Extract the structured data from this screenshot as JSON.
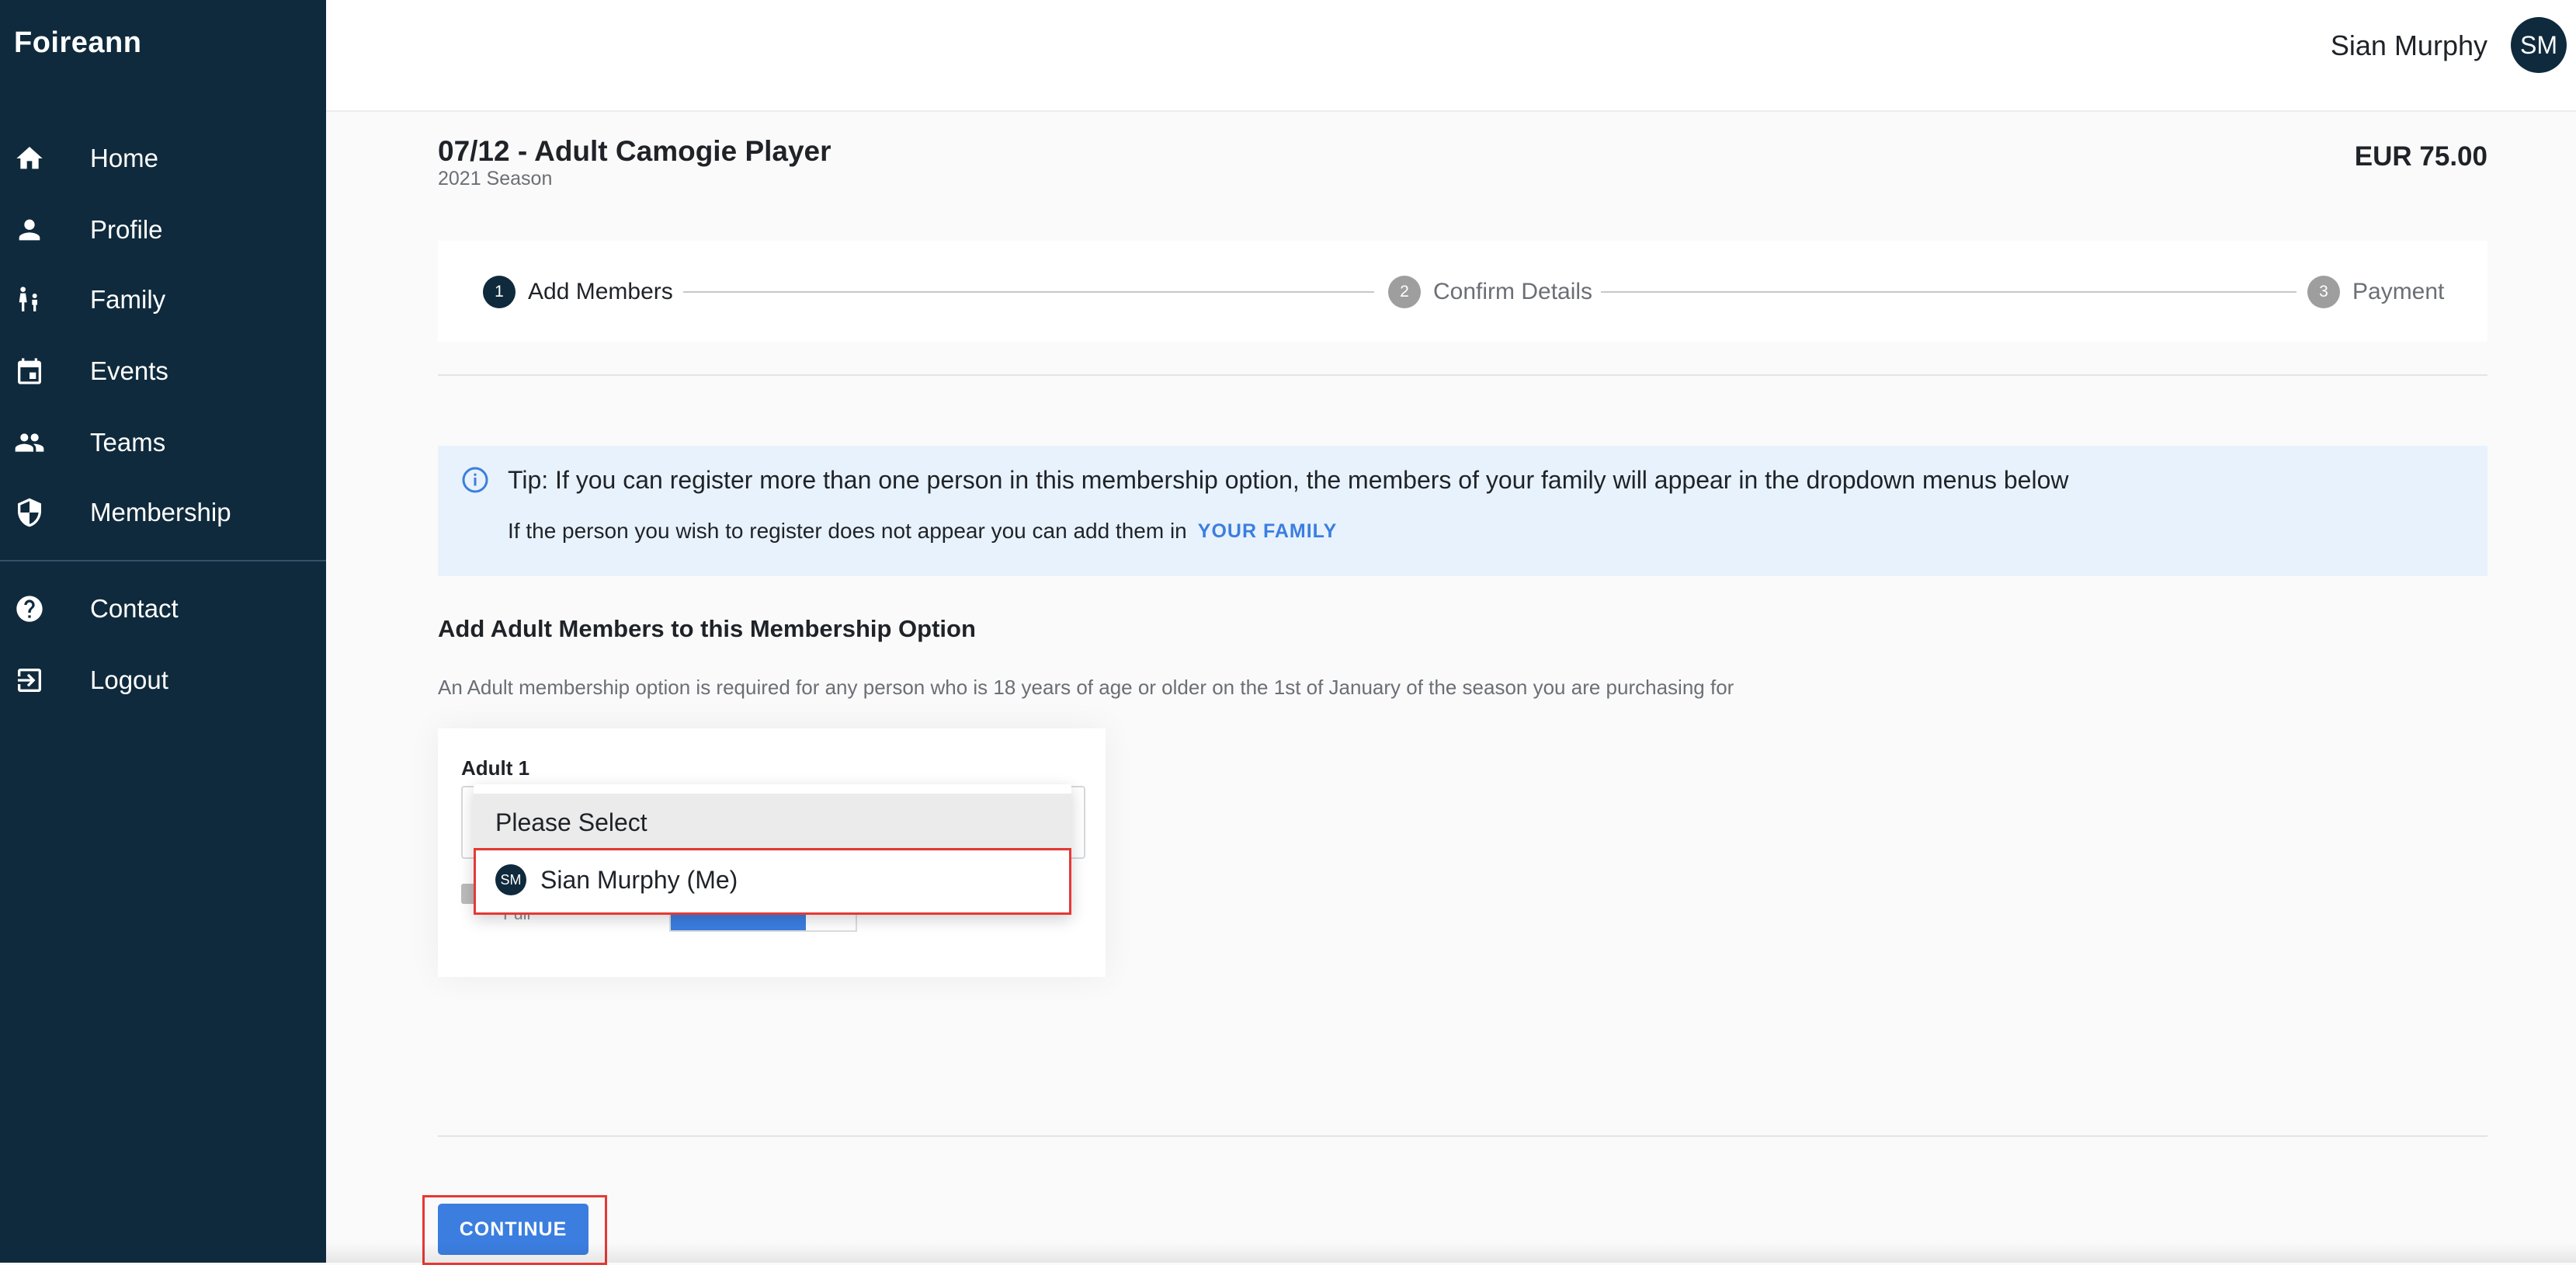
{
  "app": {
    "brand": "Foireann"
  },
  "sidebar": {
    "items": [
      {
        "label": "Home",
        "icon": "home-icon"
      },
      {
        "label": "Profile",
        "icon": "person-icon"
      },
      {
        "label": "Family",
        "icon": "family-icon"
      },
      {
        "label": "Events",
        "icon": "calendar-icon"
      },
      {
        "label": "Teams",
        "icon": "group-icon"
      },
      {
        "label": "Membership",
        "icon": "shield-icon"
      }
    ],
    "secondary": [
      {
        "label": "Contact",
        "icon": "help-icon"
      },
      {
        "label": "Logout",
        "icon": "logout-icon"
      }
    ]
  },
  "header": {
    "user_name": "Sian Murphy",
    "avatar_initials": "SM"
  },
  "membership": {
    "title": "07/12 - Adult Camogie Player",
    "season": "2021 Season",
    "price": "EUR 75.00"
  },
  "stepper": {
    "steps": [
      {
        "number": "1",
        "label": "Add Members",
        "active": true
      },
      {
        "number": "2",
        "label": "Confirm Details",
        "active": false
      },
      {
        "number": "3",
        "label": "Payment",
        "active": false
      }
    ]
  },
  "tip": {
    "text": "Tip: If you can register more than one person in this membership option, the members of your family will appear in the dropdown menus below",
    "sub_text": "If the person you wish to register does not appear you can add them in",
    "link": "YOUR FAMILY"
  },
  "section": {
    "title": "Add Adult Members to this Membership Option",
    "description": "An Adult membership option is required for any person who is 18 years of age or older on the 1st of January of the season you are purchasing for"
  },
  "adult_card": {
    "label": "Adult 1",
    "membership_type": "Full",
    "dropdown": {
      "options": [
        {
          "label": "Please Select"
        },
        {
          "label": "Sian Murphy (Me)",
          "avatar_initials": "SM"
        }
      ]
    }
  },
  "actions": {
    "continue_label": "CONTINUE"
  },
  "colors": {
    "sidebar": "#0f2a3c",
    "accent": "#3b7ee0",
    "highlight": "#e53935",
    "tip_bg": "#e8f2fc"
  }
}
